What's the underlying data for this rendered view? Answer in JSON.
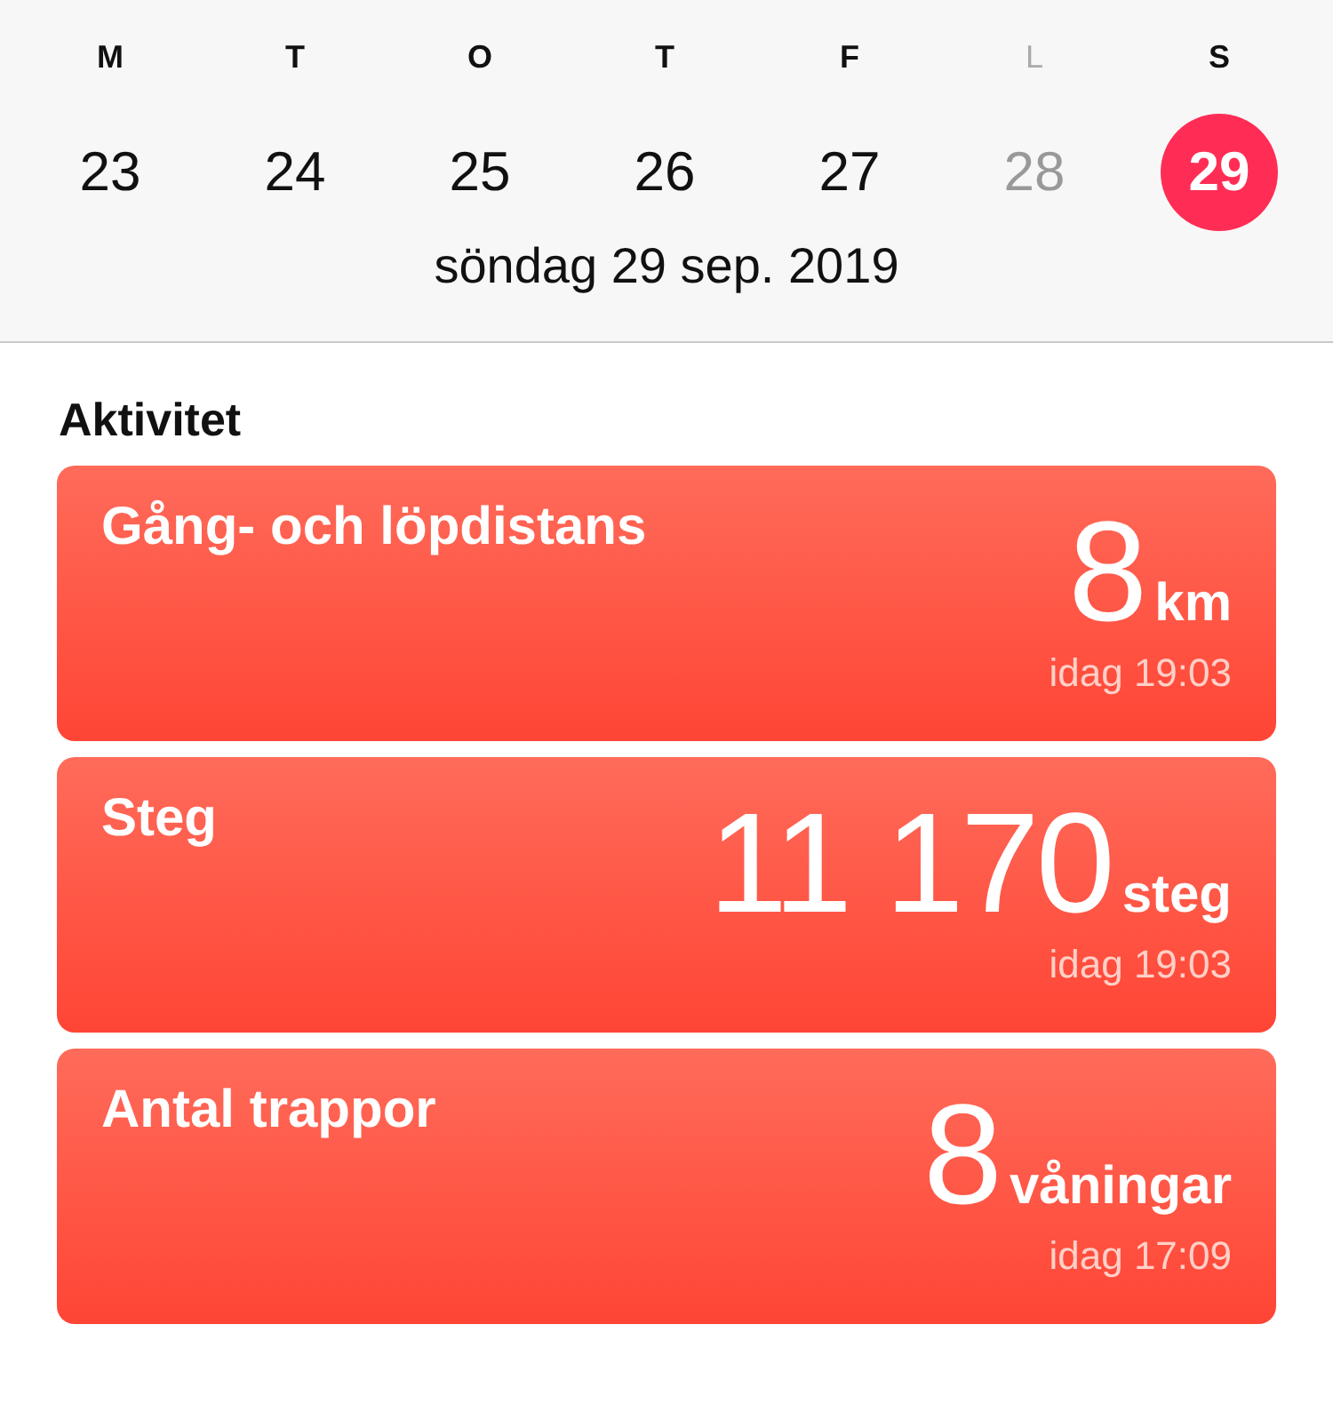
{
  "week": [
    {
      "weekday": "M",
      "date": "23",
      "selected": false,
      "muted": false
    },
    {
      "weekday": "T",
      "date": "24",
      "selected": false,
      "muted": false
    },
    {
      "weekday": "O",
      "date": "25",
      "selected": false,
      "muted": false
    },
    {
      "weekday": "T",
      "date": "26",
      "selected": false,
      "muted": false
    },
    {
      "weekday": "F",
      "date": "27",
      "selected": false,
      "muted": false
    },
    {
      "weekday": "L",
      "date": "28",
      "selected": false,
      "muted": true
    },
    {
      "weekday": "S",
      "date": "29",
      "selected": true,
      "muted": false
    }
  ],
  "selected_date": "söndag 29 sep. 2019",
  "section_title": "Aktivitet",
  "cards": [
    {
      "title": "Gång- och löpdistans",
      "value": "8",
      "unit": "km",
      "time": "idag 19:03"
    },
    {
      "title": "Steg",
      "value": "11 170",
      "unit": "steg",
      "time": "idag 19:03"
    },
    {
      "title": "Antal trappor",
      "value": "8",
      "unit": "våningar",
      "time": "idag 17:09"
    }
  ]
}
